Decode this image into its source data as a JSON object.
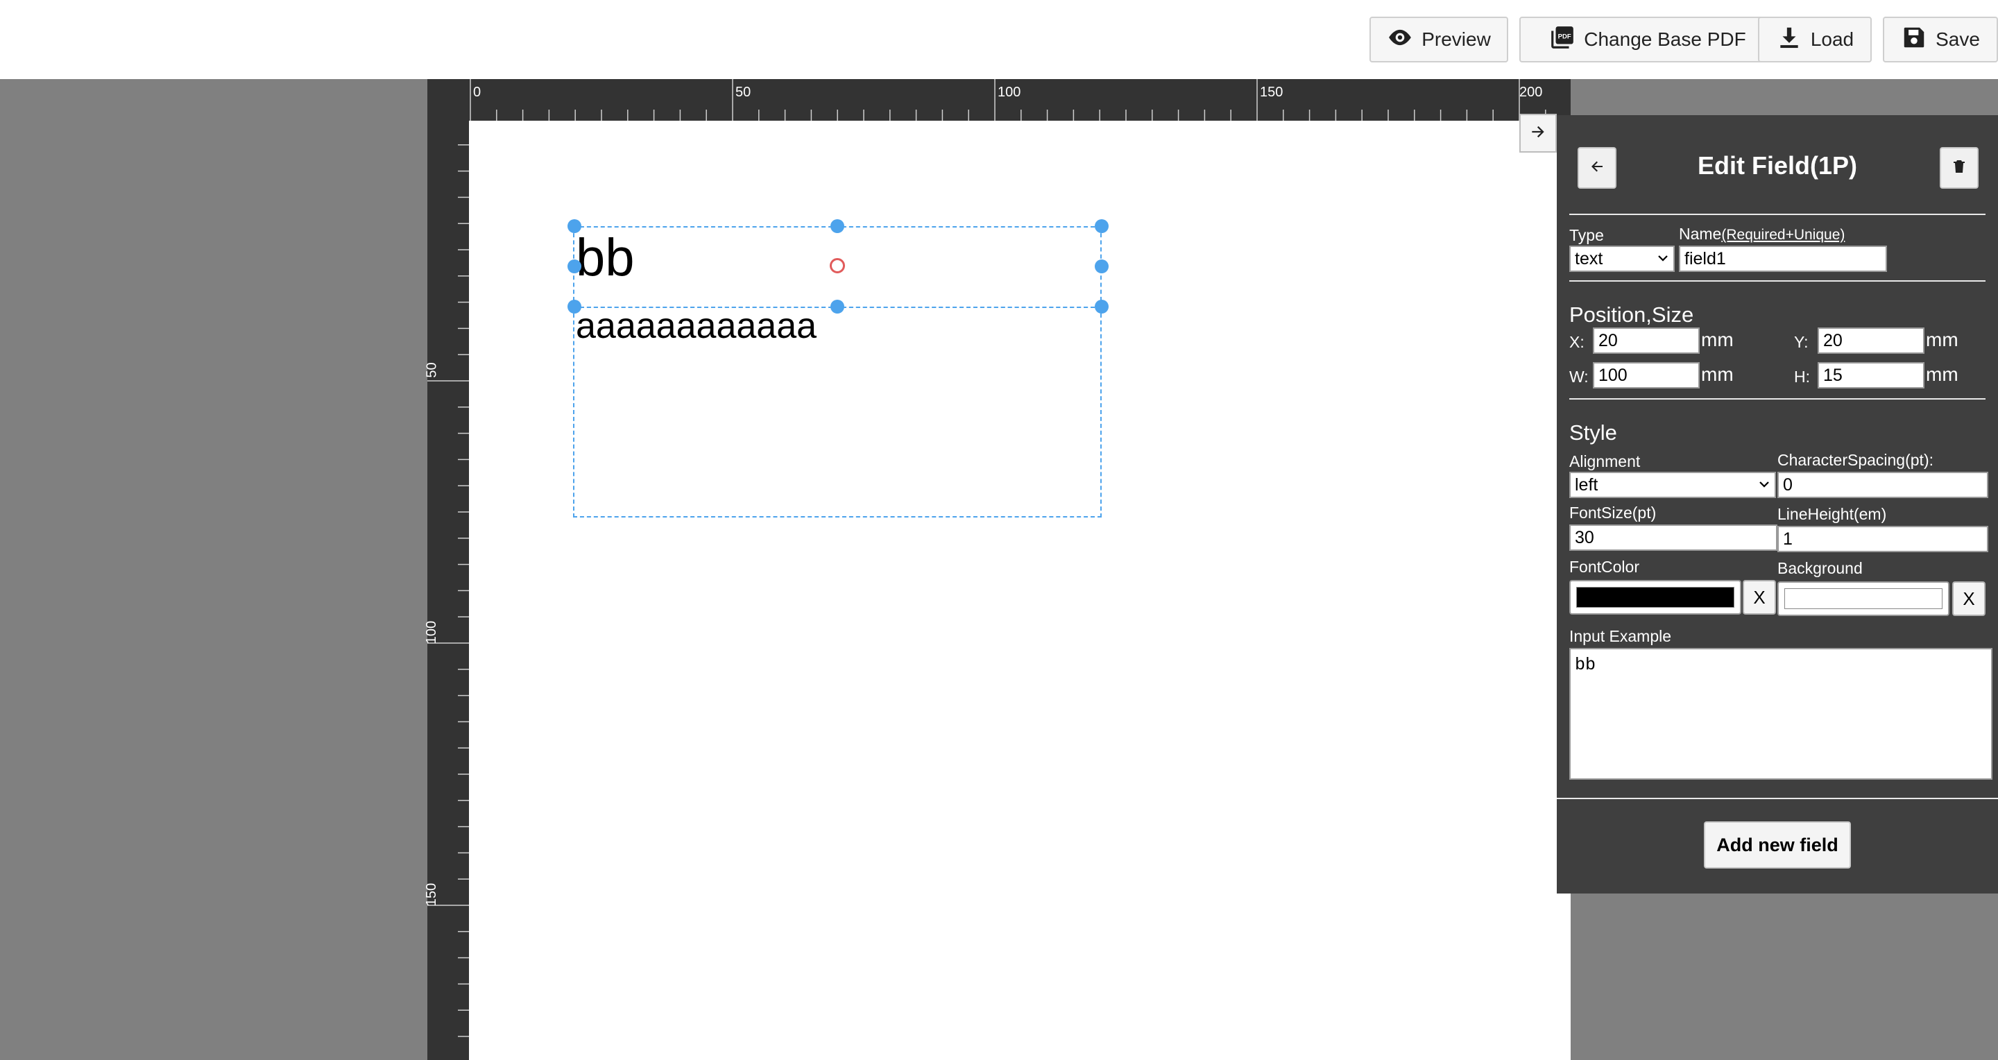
{
  "toolbar": {
    "preview_label": "Preview",
    "change_base_pdf_label": "Change Base PDF",
    "load_label": "Load",
    "save_label": "Save"
  },
  "ruler": {
    "top_labels": [
      "0",
      "50",
      "100",
      "150",
      "200"
    ],
    "left_labels": [
      "50",
      "100",
      "150"
    ]
  },
  "canvas": {
    "field1_text": "bb",
    "field2_text": "aaaaaaaaaaaa"
  },
  "sidebar": {
    "title": "Edit Field(1P)",
    "type_label": "Type",
    "type_value": "text",
    "name_label": "Name",
    "name_hint": "(Required+Unique)",
    "name_value": "field1",
    "position_title": "Position,Size",
    "x_label": "X:",
    "x_value": "20",
    "y_label": "Y:",
    "y_value": "20",
    "w_label": "W:",
    "w_value": "100",
    "h_label": "H:",
    "h_value": "15",
    "unit": "mm",
    "style_title": "Style",
    "alignment_label": "Alignment",
    "alignment_value": "left",
    "char_spacing_label": "CharacterSpacing(pt):",
    "char_spacing_value": "0",
    "font_size_label": "FontSize(pt)",
    "font_size_value": "30",
    "line_height_label": "LineHeight(em)",
    "line_height_value": "1",
    "font_color_label": "FontColor",
    "font_color_value": "#000000",
    "background_label": "Background",
    "background_value": "#ffffff",
    "clear_label": "X",
    "input_example_label": "Input Example",
    "input_example_value": "bb",
    "add_field_label": "Add new field"
  },
  "colors": {
    "ruler_bg": "#333333",
    "workspace_bg": "#808080",
    "sidebar_bg": "#3f3f3f",
    "selection": "#4da3ec",
    "rotate_handle": "#e15b5b"
  },
  "icons": [
    "eye-icon",
    "pdf-icon",
    "download-icon",
    "floppy-disk-icon",
    "arrow-right-icon",
    "arrow-left-icon",
    "trash-icon",
    "chevron-down-icon"
  ]
}
